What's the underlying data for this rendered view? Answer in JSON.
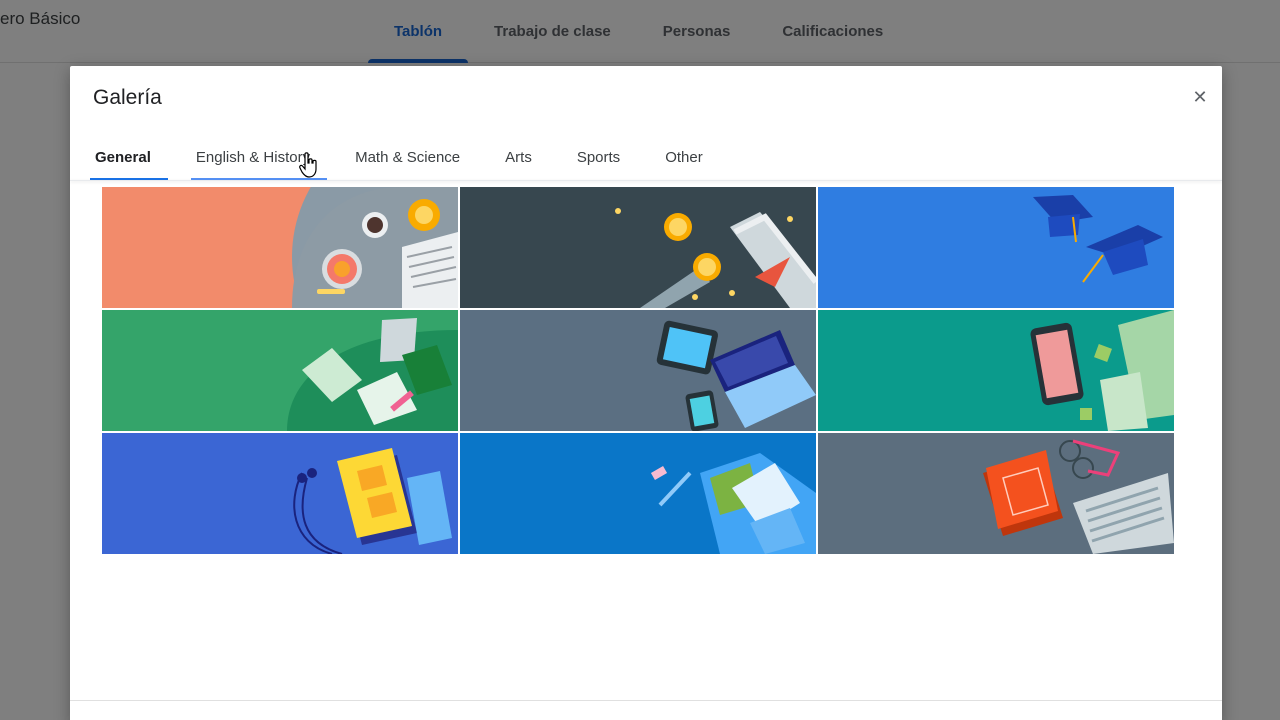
{
  "background": {
    "class_name": "ero Básico",
    "tabs": [
      {
        "label": "Tablón",
        "active": true
      },
      {
        "label": "Trabajo de clase",
        "active": false
      },
      {
        "label": "Personas",
        "active": false
      },
      {
        "label": "Calificaciones",
        "active": false
      }
    ]
  },
  "dialog": {
    "title": "Galería",
    "close_icon": "close-icon",
    "tabs": [
      {
        "label": "General",
        "active": true
      },
      {
        "label": "English & History",
        "active": false
      },
      {
        "label": "Math & Science",
        "active": false
      },
      {
        "label": "Arts",
        "active": false
      },
      {
        "label": "Sports",
        "active": false
      },
      {
        "label": "Other",
        "active": false
      }
    ],
    "themes": [
      {
        "name": "coffee-table",
        "color": "#f28b6b"
      },
      {
        "name": "diploma-medals",
        "color": "#37474f"
      },
      {
        "name": "graduation-caps",
        "color": "#2f7de1"
      },
      {
        "name": "notebooks-green",
        "color": "#34a46a"
      },
      {
        "name": "laptop-devices",
        "color": "#5b6f82"
      },
      {
        "name": "tablet-notes",
        "color": "#0b9b8c"
      },
      {
        "name": "yellow-notebook",
        "color": "#3b66d4"
      },
      {
        "name": "backpack",
        "color": "#0a76c8"
      },
      {
        "name": "book-glasses",
        "color": "#5c6e7e"
      }
    ]
  },
  "colors": {
    "accent": "#1a73e8",
    "scrim": "rgba(0,0,0,0.5)"
  }
}
